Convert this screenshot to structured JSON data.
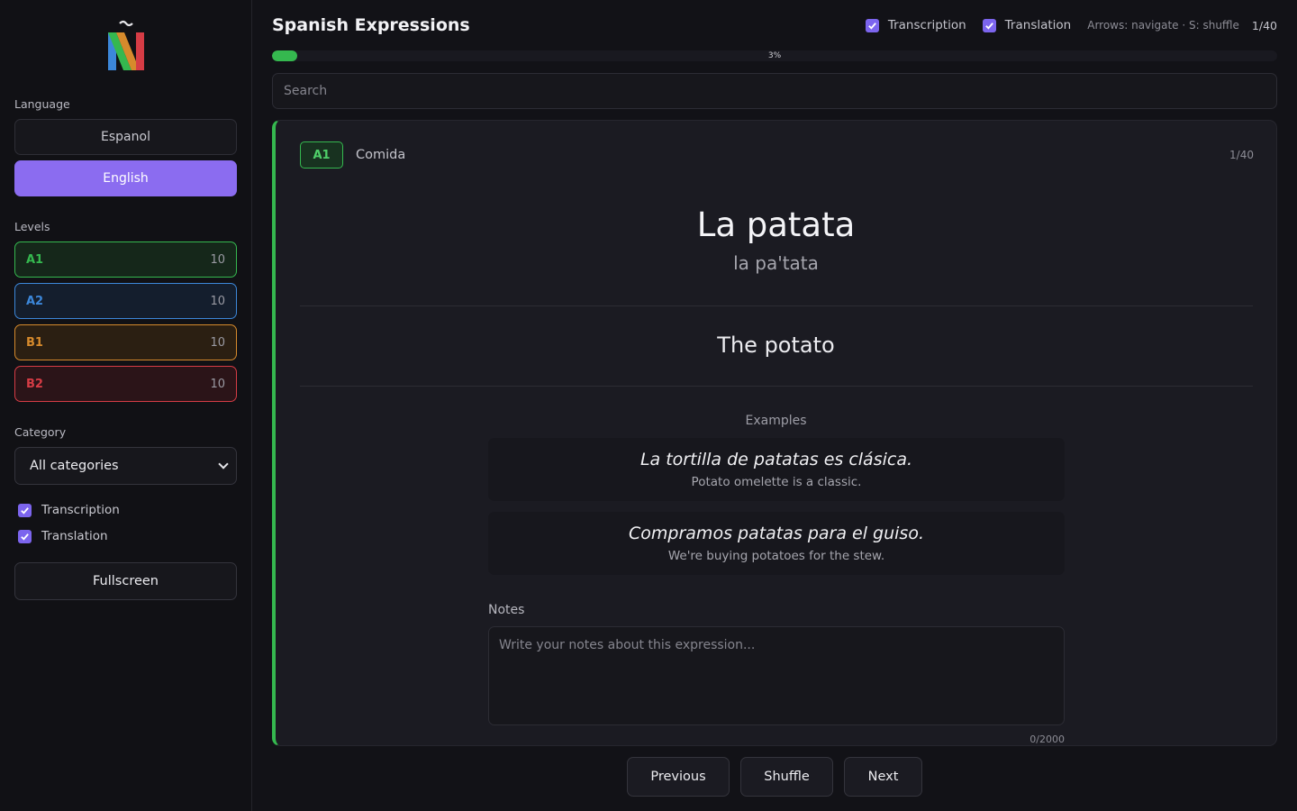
{
  "sidebar": {
    "language_label": "Language",
    "languages": [
      {
        "label": "Espanol",
        "active": false
      },
      {
        "label": "English",
        "active": true
      }
    ],
    "levels_label": "Levels",
    "levels": [
      {
        "name": "A1",
        "count": "10",
        "color": "#35b84f",
        "bg": "#15271a"
      },
      {
        "name": "A2",
        "count": "10",
        "color": "#3c87d9",
        "bg": "#141e2d"
      },
      {
        "name": "B1",
        "count": "10",
        "color": "#d68a2c",
        "bg": "#2b1f12"
      },
      {
        "name": "B2",
        "count": "10",
        "color": "#d63c45",
        "bg": "#2b1418"
      }
    ],
    "category_label": "Category",
    "category_selected": "All categories",
    "checkboxes": [
      {
        "label": "Transcription",
        "checked": true
      },
      {
        "label": "Translation",
        "checked": true
      }
    ],
    "fullscreen_label": "Fullscreen"
  },
  "header": {
    "title": "Spanish Expressions",
    "transcription_label": "Transcription",
    "translation_label": "Translation",
    "hint": "Arrows: navigate · S: shuffle",
    "counter": "1/40"
  },
  "progress": {
    "percent": 2.5,
    "label": "3%"
  },
  "search": {
    "placeholder": "Search"
  },
  "card": {
    "level": "A1",
    "category": "Comida",
    "counter": "1/40",
    "word": "La patata",
    "transcription": "la pa'tata",
    "translation": "The potato",
    "examples_title": "Examples",
    "examples": [
      {
        "es": "La tortilla de patatas es clásica.",
        "en": "Potato omelette is a classic."
      },
      {
        "es": "Compramos patatas para el guiso.",
        "en": "We're buying potatoes for the stew."
      }
    ],
    "notes_label": "Notes",
    "notes_placeholder": "Write your notes about this expression...",
    "notes_count": "0/2000"
  },
  "nav": {
    "previous": "Previous",
    "shuffle": "Shuffle",
    "next": "Next"
  },
  "colors": {
    "accent": "#8b6cf0",
    "progress": "#35b84f"
  }
}
